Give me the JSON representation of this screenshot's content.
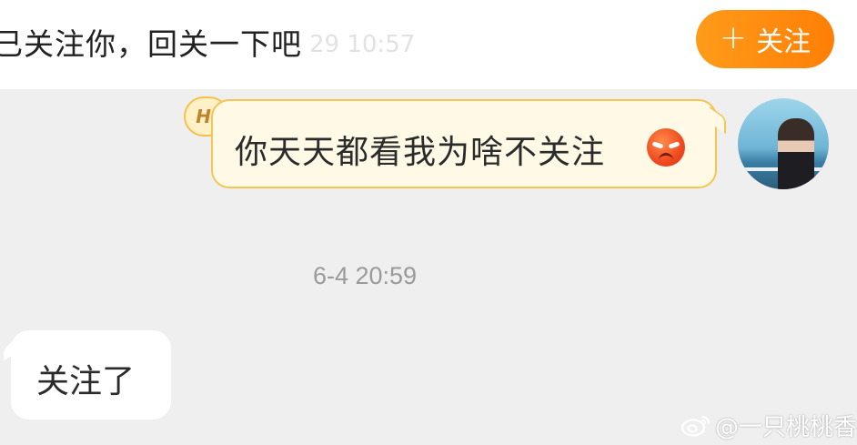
{
  "banner": {
    "text": "已关注你，回关一下吧",
    "time": "29 10:57",
    "follow_label": "关注",
    "follow_icon": "plus-icon"
  },
  "messages": {
    "outgoing": {
      "badge": "Hi",
      "text": "你天天都看我为啥不关注",
      "emoji": "angry-face-icon"
    },
    "timestamp": "6-4 20:59",
    "incoming": {
      "text": "关注了"
    }
  },
  "watermark": {
    "icon": "weibo-icon",
    "text": "@一只桃桃香"
  },
  "colors": {
    "accent": "#ff8a0e",
    "outgoing_bubble": "#fff9e6",
    "outgoing_border": "#f5c552",
    "chat_background": "#efefef"
  }
}
